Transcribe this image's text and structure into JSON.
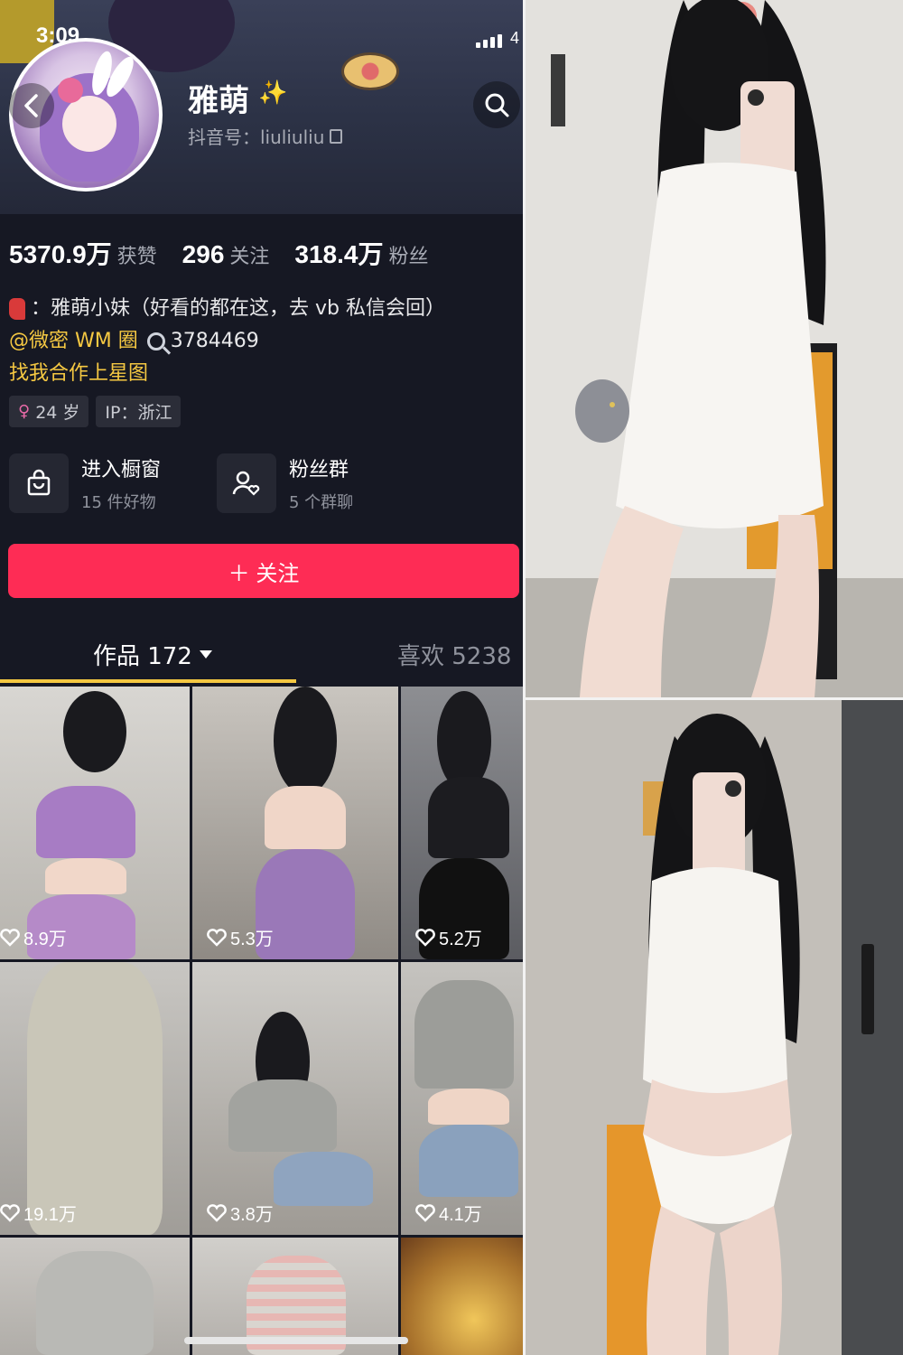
{
  "status": {
    "time": "3:09",
    "battery": "4"
  },
  "profile": {
    "nickname": "雅萌",
    "sparkle": "✨",
    "douyin_id": "抖音号：liuliuliu"
  },
  "stats": [
    {
      "value": "5370.9万",
      "label": "获赞"
    },
    {
      "value": "296",
      "label": "关注"
    },
    {
      "value": "318.4万",
      "label": "粉丝"
    }
  ],
  "bio": {
    "line1": "：雅萌小妹（好看的都在这，去 vb 私信会回）",
    "line2_link": "@微密 WM 圈",
    "line2_number": "3784469",
    "line3": "找我合作上星图"
  },
  "tags": {
    "age": "24 岁",
    "ip": "IP：浙江"
  },
  "entries": [
    {
      "title": "进入橱窗",
      "sub": "15 件好物"
    },
    {
      "title": "粉丝群",
      "sub": "5 个群聊"
    }
  ],
  "follow_label": "＋ 关注",
  "tabs": {
    "works": "作品 172",
    "likes": "喜欢 5238"
  },
  "grid": [
    {
      "likes": "8.9万"
    },
    {
      "likes": "5.3万"
    },
    {
      "likes": "5.2万"
    },
    {
      "likes": "19.1万"
    },
    {
      "likes": "3.8万"
    },
    {
      "likes": "4.1万"
    },
    {
      "likes": ""
    },
    {
      "likes": ""
    },
    {
      "likes": ""
    }
  ],
  "colors": {
    "accent": "#fe2c55",
    "link": "#f5c842",
    "background": "#161823"
  },
  "icons": [
    "back-arrow-icon",
    "search-icon",
    "copy-icon",
    "shopping-bag-icon",
    "fan-group-icon",
    "heart-icon",
    "chevron-down-icon",
    "female-icon",
    "magnifier-icon",
    "scarf-icon"
  ]
}
